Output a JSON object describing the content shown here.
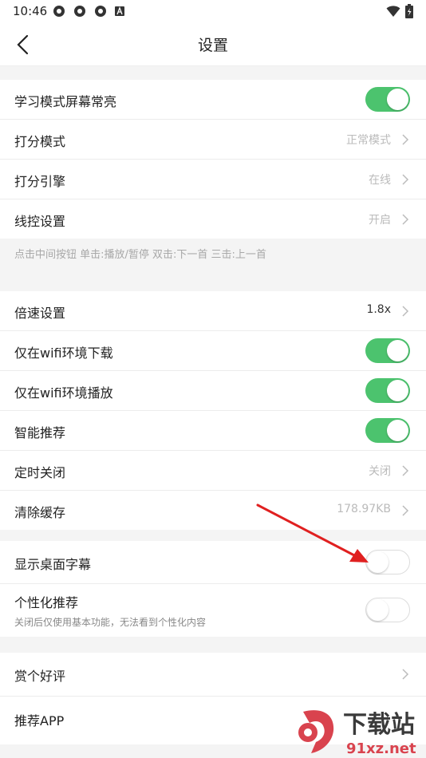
{
  "status_bar": {
    "time": "10:46"
  },
  "header": {
    "title": "设置"
  },
  "group1": {
    "items": [
      {
        "label": "学习模式屏幕常亮",
        "type": "toggle",
        "on": true
      },
      {
        "label": "打分模式",
        "value": "正常模式"
      },
      {
        "label": "打分引擎",
        "value": "在线"
      },
      {
        "label": "线控设置",
        "value": "开启"
      }
    ],
    "hint": "点击中间按钮 单击:播放/暂停 双击:下一首 三击:上一首"
  },
  "group2": {
    "items": [
      {
        "label": "倍速设置",
        "value": "1.8x"
      },
      {
        "label": "仅在wifi环境下载",
        "type": "toggle",
        "on": true
      },
      {
        "label": "仅在wifi环境播放",
        "type": "toggle",
        "on": true
      },
      {
        "label": "智能推荐",
        "type": "toggle",
        "on": true
      },
      {
        "label": "定时关闭",
        "value": "关闭"
      },
      {
        "label": "清除缓存",
        "value": "178.97KB"
      }
    ]
  },
  "group3": {
    "items": [
      {
        "label": "显示桌面字幕",
        "type": "toggle",
        "on": false
      },
      {
        "label": "个性化推荐",
        "sub": "关闭后仅使用基本功能，无法看到个性化内容",
        "type": "toggle",
        "on": false
      }
    ]
  },
  "group4": {
    "items": [
      {
        "label": "赏个好评"
      },
      {
        "label": "推荐APP"
      }
    ]
  },
  "watermark": {
    "text1": "下载站",
    "text2": "91xz.net"
  },
  "colors": {
    "toggle_on": "#4cc36e",
    "arrow": "#e02020"
  }
}
